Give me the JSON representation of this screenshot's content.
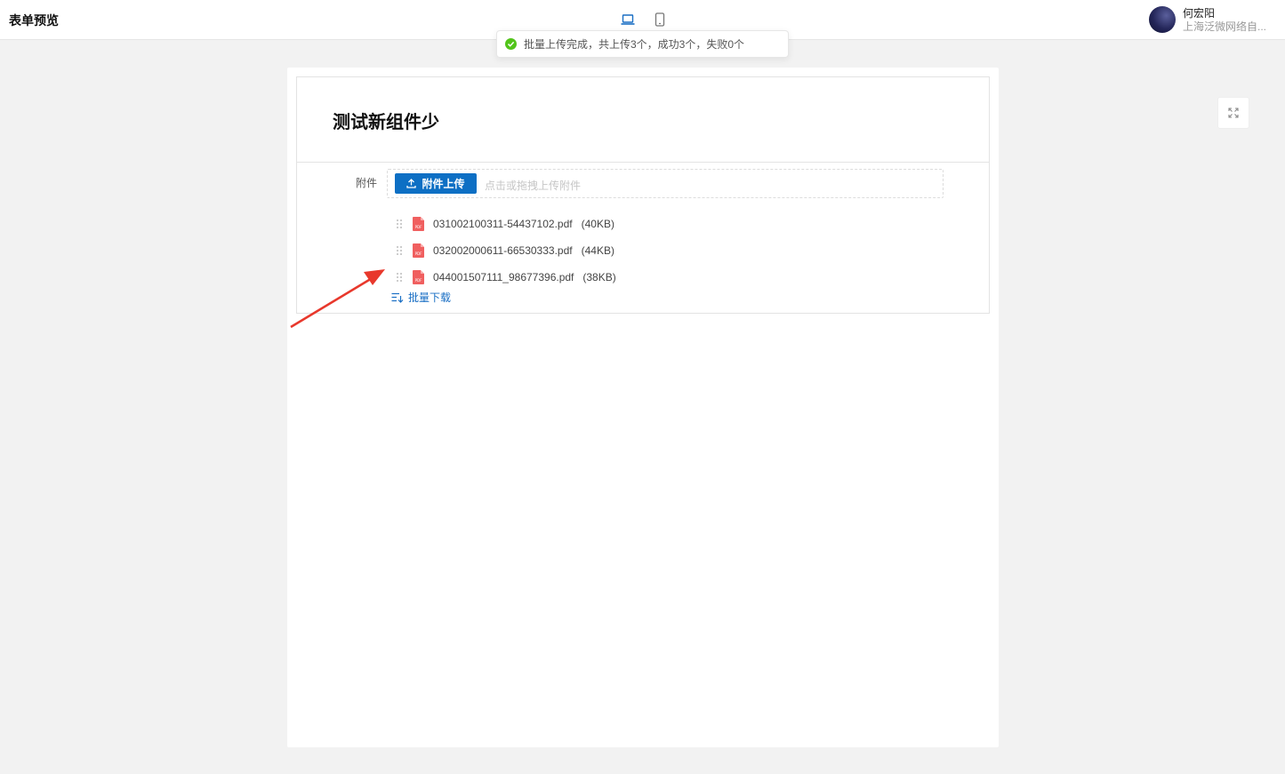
{
  "header": {
    "title": "表单预览",
    "device_modes": [
      "desktop",
      "mobile"
    ],
    "active_device": "desktop"
  },
  "user": {
    "name": "何宏阳",
    "org": "上海泛微网络自..."
  },
  "toast": {
    "message": "批量上传完成，共上传3个，成功3个，失败0个",
    "status_color": "#52c41a"
  },
  "form": {
    "title": "测试新组件少",
    "field_label": "附件",
    "upload_button": "附件上传",
    "upload_hint": "点击或拖拽上传附件",
    "files": [
      {
        "name": "031002100311-54437102.pdf",
        "size": "(40KB)"
      },
      {
        "name": "032002000611-66530333.pdf",
        "size": "(44KB)"
      },
      {
        "name": "044001507111_98677396.pdf",
        "size": "(38KB)"
      }
    ],
    "batch_download": "批量下载"
  },
  "colors": {
    "primary": "#0d6fc4",
    "annotation_arrow": "#e8382c",
    "pdf_icon": "#f05f5f"
  },
  "icons": {
    "desktop": "laptop-icon",
    "mobile": "phone-icon",
    "fullscreen": "fullscreen-icon",
    "upload": "upload-icon",
    "drag": "drag-handle-icon",
    "file": "pdf-file-icon",
    "download": "batch-download-icon"
  }
}
